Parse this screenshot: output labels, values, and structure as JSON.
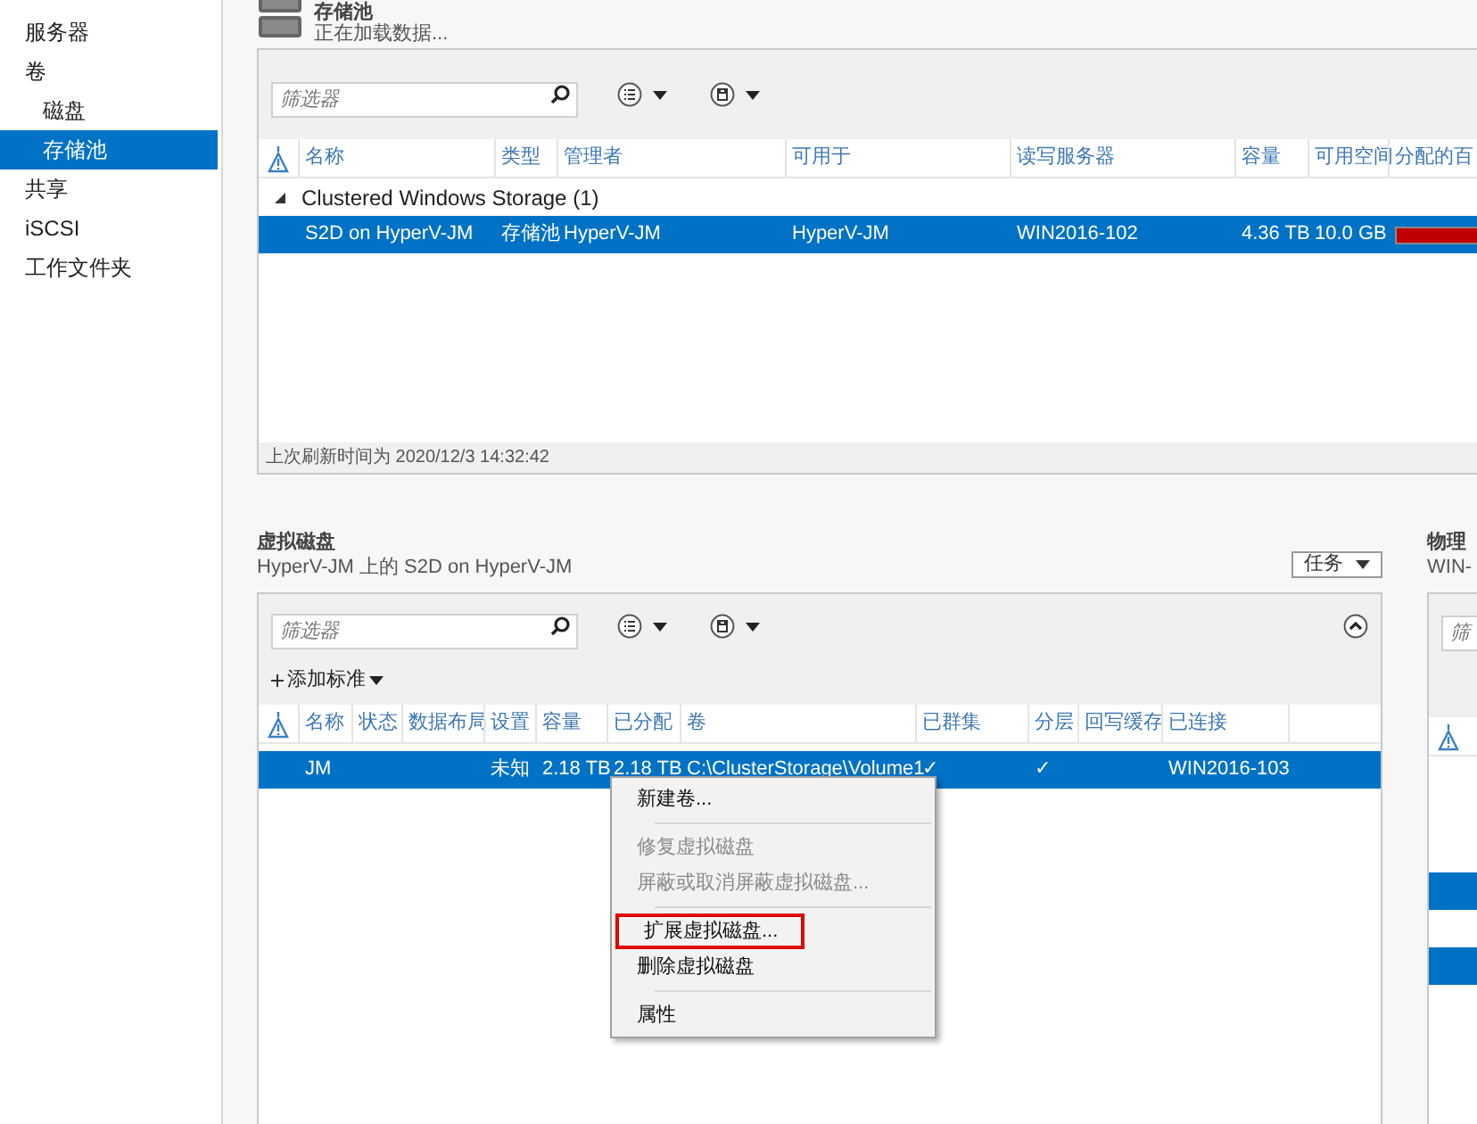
{
  "sidebar": {
    "items": [
      {
        "label": "服务器",
        "selected": false
      },
      {
        "label": "卷",
        "selected": false,
        "children": [
          {
            "label": "磁盘",
            "selected": false
          },
          {
            "label": "存储池",
            "selected": true
          }
        ]
      },
      {
        "label": "共享",
        "selected": false
      },
      {
        "label": "iSCSI",
        "selected": false
      },
      {
        "label": "工作文件夹",
        "selected": false
      }
    ]
  },
  "storage_pools": {
    "title": "存储池",
    "subtitle": "正在加载数据...",
    "filter": {
      "placeholder": "筛选器"
    },
    "columns": [
      "名称",
      "类型",
      "管理者",
      "可用于",
      "读写服务器",
      "容量",
      "可用空间",
      "分配的百"
    ],
    "group": {
      "label": "Clustered Windows Storage (1)",
      "expanded": true
    },
    "rows": [
      {
        "selected": true,
        "cells": [
          "S2D on HyperV-JM",
          "存储池",
          "HyperV-JM",
          "HyperV-JM",
          "WIN2016-102",
          "4.36 TB",
          "10.0 GB"
        ],
        "level": 1
      }
    ],
    "footer": "上次刷新时间为 2020/12/3 14:32:42"
  },
  "virtual_disks": {
    "title": "虚拟磁盘",
    "subtitle": "HyperV-JM 上的 S2D on HyperV-JM",
    "tasks_button": "任务",
    "filter": {
      "placeholder": "筛选器"
    },
    "add_criteria": "添加标准",
    "columns": [
      "名称",
      "状态",
      "数据布局",
      "设置",
      "容量",
      "已分配",
      "卷",
      "已群集",
      "分层",
      "回写缓存",
      "已连接"
    ],
    "rows": [
      {
        "selected": true,
        "cells": [
          "JM",
          "",
          "",
          "未知",
          "2.18 TB",
          "2.18 TB",
          "C:\\ClusterStorage\\Volume1",
          "✓",
          "✓",
          "",
          "WIN2016-103"
        ]
      }
    ]
  },
  "context_menu": [
    {
      "kind": "item",
      "label": "新建卷...",
      "disabled": false,
      "highlighted": false
    },
    {
      "kind": "separator"
    },
    {
      "kind": "item",
      "label": "修复虚拟磁盘",
      "disabled": true,
      "highlighted": false
    },
    {
      "kind": "item",
      "label": "屏蔽或取消屏蔽虚拟磁盘...",
      "disabled": true,
      "highlighted": false
    },
    {
      "kind": "separator"
    },
    {
      "kind": "item",
      "label": "扩展虚拟磁盘...",
      "disabled": false,
      "highlighted": true
    },
    {
      "kind": "item",
      "label": "删除虚拟磁盘",
      "disabled": false,
      "highlighted": false
    },
    {
      "kind": "separator"
    },
    {
      "kind": "item",
      "label": "属性",
      "disabled": false,
      "highlighted": false
    }
  ],
  "physical_disks": {
    "title": "物理",
    "subtitle": "WIN-",
    "filter": {
      "placeholder": "筛"
    },
    "rows": [
      {
        "selected": false
      },
      {
        "selected": false
      },
      {
        "selected": false
      },
      {
        "selected": true
      },
      {
        "selected": false
      },
      {
        "selected": true
      }
    ]
  }
}
